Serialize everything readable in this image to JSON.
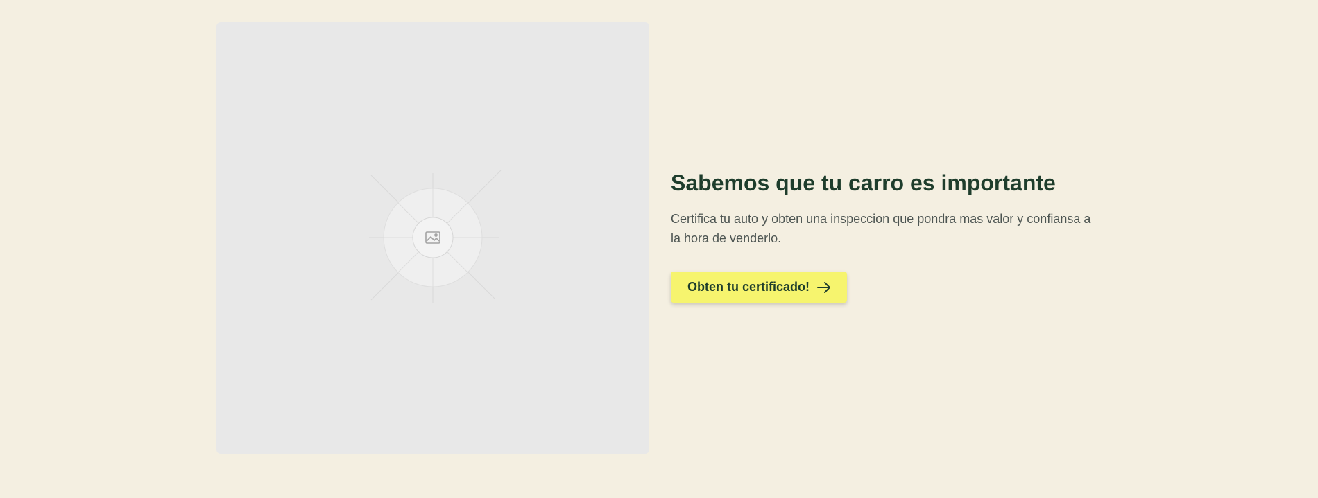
{
  "hero": {
    "image": {
      "icon": "image-placeholder-icon"
    },
    "title": "Sabemos que tu carro es importante",
    "description": "Certifica tu auto y obten una inspeccion que pondra mas valor y confiansa a la hora de venderlo.",
    "cta": {
      "label": "Obten tu certificado!",
      "icon": "arrow-right-icon"
    }
  },
  "colors": {
    "page_background": "#f4efe1",
    "placeholder_background": "#e8e8e8",
    "heading": "#1e3d2c",
    "body_text": "#4d5552",
    "cta_background": "#f6f46e"
  }
}
